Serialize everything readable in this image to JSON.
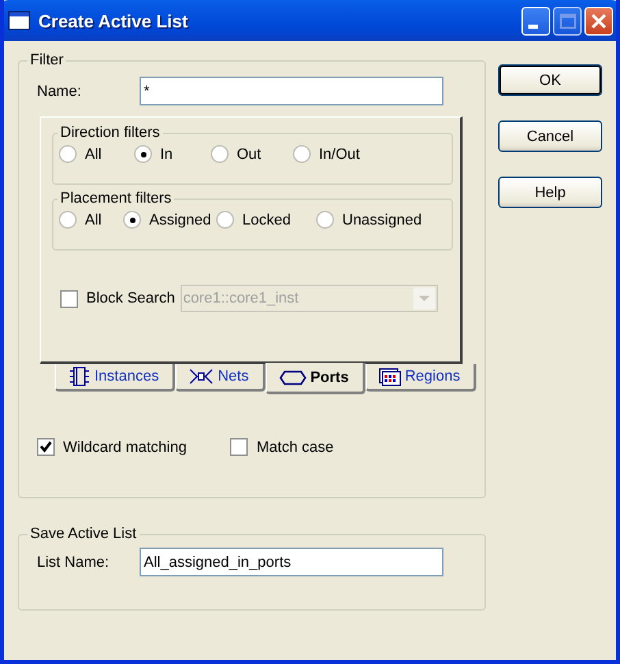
{
  "window": {
    "title": "Create Active List"
  },
  "buttons": [
    {
      "label": "OK",
      "default": true
    },
    {
      "label": "Cancel",
      "default": false
    },
    {
      "label": "Help",
      "default": false
    }
  ],
  "filter": {
    "title": "Filter",
    "name_label": "Name:",
    "name_value": "*",
    "direction": {
      "title": "Direction filters",
      "options": [
        {
          "label": "All",
          "selected": false
        },
        {
          "label": "In",
          "selected": true
        },
        {
          "label": "Out",
          "selected": false
        },
        {
          "label": "In/Out",
          "selected": false
        }
      ]
    },
    "placement": {
      "title": "Placement filters",
      "options": [
        {
          "label": "All",
          "selected": false
        },
        {
          "label": "Assigned",
          "selected": true
        },
        {
          "label": "Locked",
          "selected": false
        },
        {
          "label": "Unassigned",
          "selected": false
        }
      ]
    },
    "block_search": {
      "label": "Block Search",
      "checked": false,
      "value": "core1::core1_inst"
    },
    "tabs": [
      {
        "label": "Instances",
        "kind": "chip",
        "selected": false
      },
      {
        "label": "Nets",
        "kind": "net",
        "selected": false
      },
      {
        "label": "Ports",
        "kind": "port",
        "selected": true
      },
      {
        "label": "Regions",
        "kind": "grid",
        "selected": false
      }
    ],
    "wildcard": {
      "label": "Wildcard matching",
      "checked": true
    },
    "match_case": {
      "label": "Match case",
      "checked": false
    }
  },
  "save": {
    "title": "Save Active List",
    "label": "List Name:",
    "value": "All_assigned_in_ports"
  }
}
